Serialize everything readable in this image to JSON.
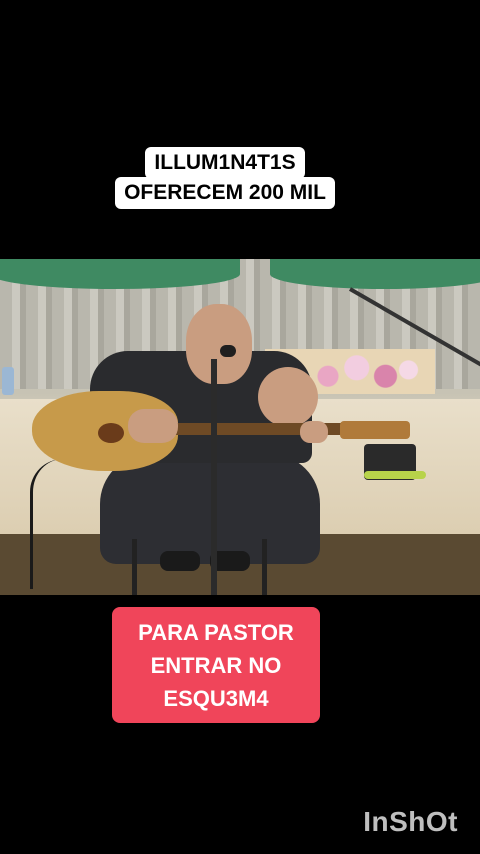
{
  "captions": {
    "top": [
      "ILLUM1N4T1S",
      "OFERECEM 200 MIL"
    ],
    "bottom": [
      "PARA PASTOR",
      "ENTRAR NO",
      "ESQU3M4"
    ]
  },
  "watermark": "InShOt",
  "colors": {
    "background": "#000000",
    "top_caption_bg": "#ffffff",
    "bottom_caption_bg": "#f0455a",
    "curtain_valance": "#3f8a62"
  },
  "scene": {
    "description_icon": "video-frame-guitarist"
  }
}
